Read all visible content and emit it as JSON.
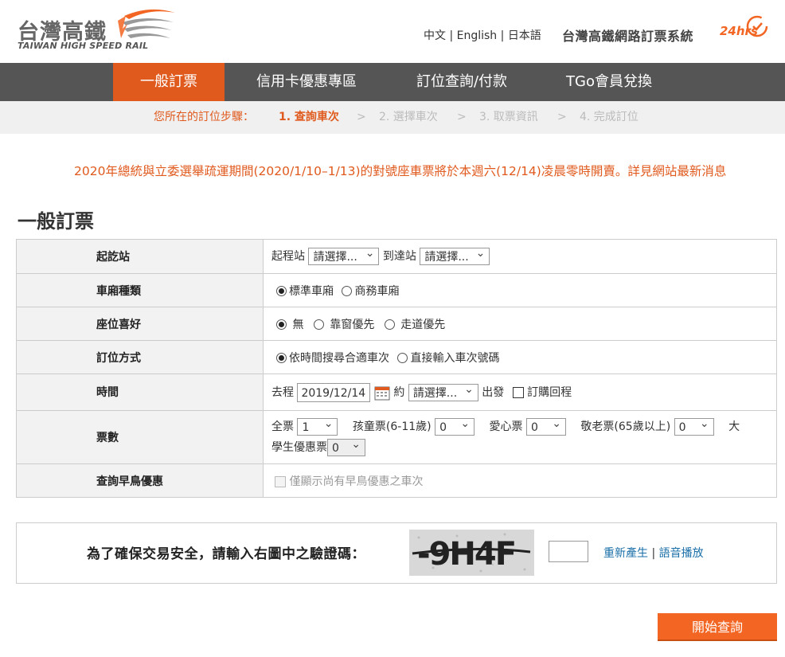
{
  "header": {
    "logo_cn": "台灣高鐵",
    "logo_en": "TAIWAN HIGH SPEED RAIL",
    "lang": [
      "中文",
      "English",
      "日本語"
    ],
    "lang_sep": "|",
    "system_title": "台灣高鐵網路訂票系統",
    "system_24": "24hrs"
  },
  "nav": {
    "items": [
      "一般訂票",
      "信用卡優惠專區",
      "訂位查詢/付款",
      "TGo會員兌換"
    ]
  },
  "steps": {
    "label": "您所在的訂位步驟：",
    "items": [
      "1. 查詢車次",
      "2. 選擇車次",
      "3. 取票資訊",
      "4. 完成訂位"
    ],
    "sep": ">"
  },
  "notice": "2020年總統與立委選舉疏運期間(2020/1/10–1/13)的對號座車票將於本週六(12/14)凌晨零時開賣。詳見網站最新消息",
  "page_title": "一般訂票",
  "form": {
    "station": {
      "label": "起訖站",
      "from_label": "起程站",
      "from_value": "請選擇...",
      "to_label": "到達站",
      "to_value": "請選擇..."
    },
    "car_type": {
      "label": "車廂種類",
      "options": [
        "標準車廂",
        "商務車廂"
      ],
      "selected": "標準車廂"
    },
    "seat_pref": {
      "label": "座位喜好",
      "options": [
        "無",
        "靠窗優先",
        "走道優先"
      ],
      "selected": "無"
    },
    "booking_method": {
      "label": "訂位方式",
      "options": [
        "依時間搜尋合適車次",
        "直接輸入車次號碼"
      ],
      "selected": "依時間搜尋合適車次"
    },
    "time": {
      "label": "時間",
      "outbound_label": "去程",
      "date": "2019/12/14",
      "approx_label": "約",
      "time_value": "請選擇...",
      "depart_label": "出發",
      "return_label": "訂購回程"
    },
    "tickets": {
      "label": "票數",
      "adult_label": "全票",
      "adult": "1",
      "child_label": "孩童票(6-11歲)",
      "child": "0",
      "disabled_label": "愛心票",
      "disabled": "0",
      "senior_label": "敬老票(65歲以上)",
      "senior": "0",
      "student_label_a": "大",
      "student_label_b": "學生優惠票",
      "student": "0"
    },
    "early_bird": {
      "label": "查詢早鳥優惠",
      "checkbox_label": "僅顯示尚有早鳥優惠之車次"
    }
  },
  "captcha": {
    "label": "為了確保交易安全，請輸入右圖中之驗證碼：",
    "image_text": "-9H4F",
    "regen": "重新產生",
    "sep": "|",
    "audio": "語音播放"
  },
  "submit_label": "開始查詢",
  "colors": {
    "accent": "#f26522",
    "nav_bg": "#555555",
    "nav_active": "#e05a1e",
    "link": "#1a6fa8"
  }
}
